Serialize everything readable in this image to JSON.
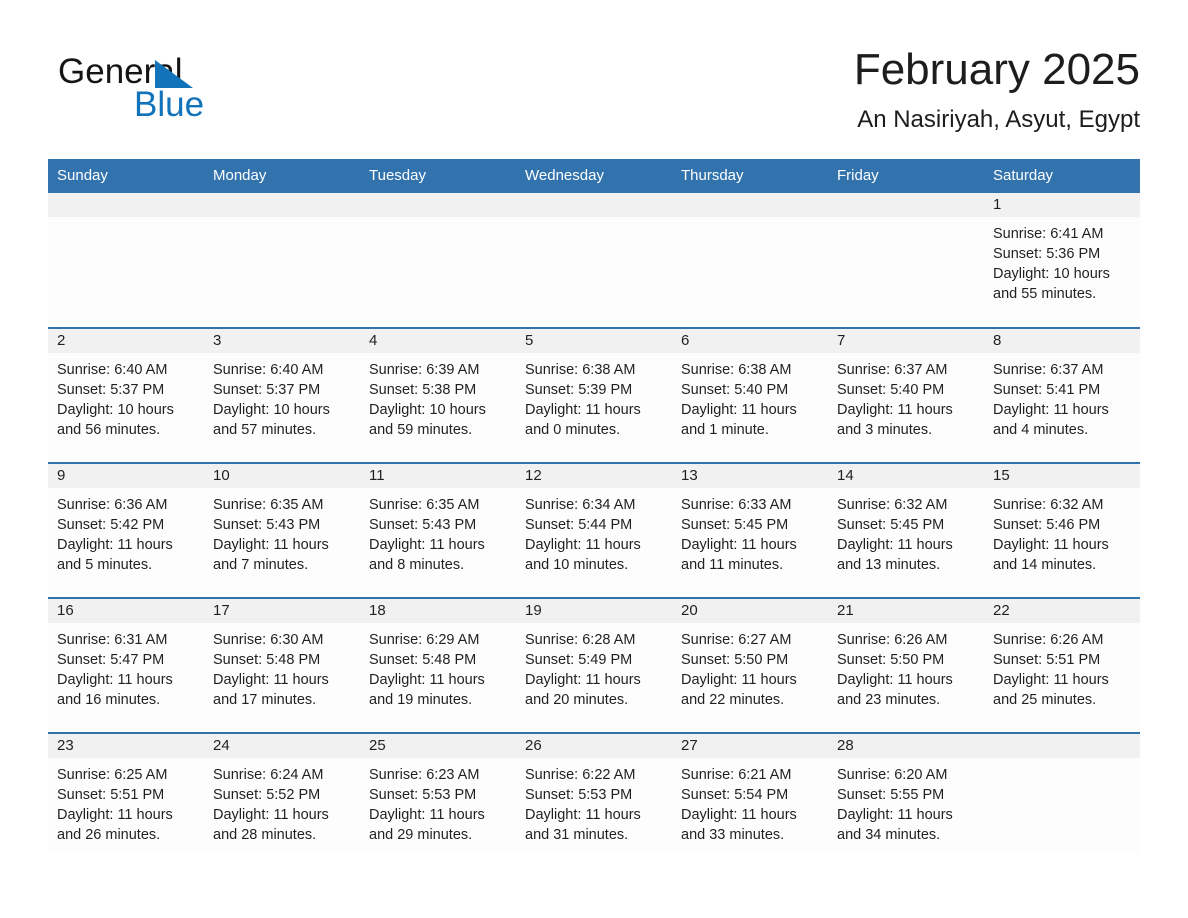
{
  "brand": {
    "logo_text_top": "General",
    "logo_text_bottom": "Blue",
    "logo_icon": "blue-triangle-mark",
    "accent_color": "#1273bb",
    "header_color": "#3273ae"
  },
  "header": {
    "title": "February 2025",
    "subtitle": "An Nasiriyah, Asyut, Egypt"
  },
  "weekdays": [
    "Sunday",
    "Monday",
    "Tuesday",
    "Wednesday",
    "Thursday",
    "Friday",
    "Saturday"
  ],
  "weeks": [
    [
      {
        "day": "",
        "empty": true
      },
      {
        "day": "",
        "empty": true
      },
      {
        "day": "",
        "empty": true
      },
      {
        "day": "",
        "empty": true
      },
      {
        "day": "",
        "empty": true
      },
      {
        "day": "",
        "empty": true
      },
      {
        "day": "1",
        "sunrise": "Sunrise: 6:41 AM",
        "sunset": "Sunset: 5:36 PM",
        "daylight1": "Daylight: 10 hours",
        "daylight2": "and 55 minutes."
      }
    ],
    [
      {
        "day": "2",
        "sunrise": "Sunrise: 6:40 AM",
        "sunset": "Sunset: 5:37 PM",
        "daylight1": "Daylight: 10 hours",
        "daylight2": "and 56 minutes."
      },
      {
        "day": "3",
        "sunrise": "Sunrise: 6:40 AM",
        "sunset": "Sunset: 5:37 PM",
        "daylight1": "Daylight: 10 hours",
        "daylight2": "and 57 minutes."
      },
      {
        "day": "4",
        "sunrise": "Sunrise: 6:39 AM",
        "sunset": "Sunset: 5:38 PM",
        "daylight1": "Daylight: 10 hours",
        "daylight2": "and 59 minutes."
      },
      {
        "day": "5",
        "sunrise": "Sunrise: 6:38 AM",
        "sunset": "Sunset: 5:39 PM",
        "daylight1": "Daylight: 11 hours",
        "daylight2": "and 0 minutes."
      },
      {
        "day": "6",
        "sunrise": "Sunrise: 6:38 AM",
        "sunset": "Sunset: 5:40 PM",
        "daylight1": "Daylight: 11 hours",
        "daylight2": "and 1 minute."
      },
      {
        "day": "7",
        "sunrise": "Sunrise: 6:37 AM",
        "sunset": "Sunset: 5:40 PM",
        "daylight1": "Daylight: 11 hours",
        "daylight2": "and 3 minutes."
      },
      {
        "day": "8",
        "sunrise": "Sunrise: 6:37 AM",
        "sunset": "Sunset: 5:41 PM",
        "daylight1": "Daylight: 11 hours",
        "daylight2": "and 4 minutes."
      }
    ],
    [
      {
        "day": "9",
        "sunrise": "Sunrise: 6:36 AM",
        "sunset": "Sunset: 5:42 PM",
        "daylight1": "Daylight: 11 hours",
        "daylight2": "and 5 minutes."
      },
      {
        "day": "10",
        "sunrise": "Sunrise: 6:35 AM",
        "sunset": "Sunset: 5:43 PM",
        "daylight1": "Daylight: 11 hours",
        "daylight2": "and 7 minutes."
      },
      {
        "day": "11",
        "sunrise": "Sunrise: 6:35 AM",
        "sunset": "Sunset: 5:43 PM",
        "daylight1": "Daylight: 11 hours",
        "daylight2": "and 8 minutes."
      },
      {
        "day": "12",
        "sunrise": "Sunrise: 6:34 AM",
        "sunset": "Sunset: 5:44 PM",
        "daylight1": "Daylight: 11 hours",
        "daylight2": "and 10 minutes."
      },
      {
        "day": "13",
        "sunrise": "Sunrise: 6:33 AM",
        "sunset": "Sunset: 5:45 PM",
        "daylight1": "Daylight: 11 hours",
        "daylight2": "and 11 minutes."
      },
      {
        "day": "14",
        "sunrise": "Sunrise: 6:32 AM",
        "sunset": "Sunset: 5:45 PM",
        "daylight1": "Daylight: 11 hours",
        "daylight2": "and 13 minutes."
      },
      {
        "day": "15",
        "sunrise": "Sunrise: 6:32 AM",
        "sunset": "Sunset: 5:46 PM",
        "daylight1": "Daylight: 11 hours",
        "daylight2": "and 14 minutes."
      }
    ],
    [
      {
        "day": "16",
        "sunrise": "Sunrise: 6:31 AM",
        "sunset": "Sunset: 5:47 PM",
        "daylight1": "Daylight: 11 hours",
        "daylight2": "and 16 minutes."
      },
      {
        "day": "17",
        "sunrise": "Sunrise: 6:30 AM",
        "sunset": "Sunset: 5:48 PM",
        "daylight1": "Daylight: 11 hours",
        "daylight2": "and 17 minutes."
      },
      {
        "day": "18",
        "sunrise": "Sunrise: 6:29 AM",
        "sunset": "Sunset: 5:48 PM",
        "daylight1": "Daylight: 11 hours",
        "daylight2": "and 19 minutes."
      },
      {
        "day": "19",
        "sunrise": "Sunrise: 6:28 AM",
        "sunset": "Sunset: 5:49 PM",
        "daylight1": "Daylight: 11 hours",
        "daylight2": "and 20 minutes."
      },
      {
        "day": "20",
        "sunrise": "Sunrise: 6:27 AM",
        "sunset": "Sunset: 5:50 PM",
        "daylight1": "Daylight: 11 hours",
        "daylight2": "and 22 minutes."
      },
      {
        "day": "21",
        "sunrise": "Sunrise: 6:26 AM",
        "sunset": "Sunset: 5:50 PM",
        "daylight1": "Daylight: 11 hours",
        "daylight2": "and 23 minutes."
      },
      {
        "day": "22",
        "sunrise": "Sunrise: 6:26 AM",
        "sunset": "Sunset: 5:51 PM",
        "daylight1": "Daylight: 11 hours",
        "daylight2": "and 25 minutes."
      }
    ],
    [
      {
        "day": "23",
        "sunrise": "Sunrise: 6:25 AM",
        "sunset": "Sunset: 5:51 PM",
        "daylight1": "Daylight: 11 hours",
        "daylight2": "and 26 minutes."
      },
      {
        "day": "24",
        "sunrise": "Sunrise: 6:24 AM",
        "sunset": "Sunset: 5:52 PM",
        "daylight1": "Daylight: 11 hours",
        "daylight2": "and 28 minutes."
      },
      {
        "day": "25",
        "sunrise": "Sunrise: 6:23 AM",
        "sunset": "Sunset: 5:53 PM",
        "daylight1": "Daylight: 11 hours",
        "daylight2": "and 29 minutes."
      },
      {
        "day": "26",
        "sunrise": "Sunrise: 6:22 AM",
        "sunset": "Sunset: 5:53 PM",
        "daylight1": "Daylight: 11 hours",
        "daylight2": "and 31 minutes."
      },
      {
        "day": "27",
        "sunrise": "Sunrise: 6:21 AM",
        "sunset": "Sunset: 5:54 PM",
        "daylight1": "Daylight: 11 hours",
        "daylight2": "and 33 minutes."
      },
      {
        "day": "28",
        "sunrise": "Sunrise: 6:20 AM",
        "sunset": "Sunset: 5:55 PM",
        "daylight1": "Daylight: 11 hours",
        "daylight2": "and 34 minutes."
      },
      {
        "day": "",
        "empty": true
      }
    ]
  ]
}
